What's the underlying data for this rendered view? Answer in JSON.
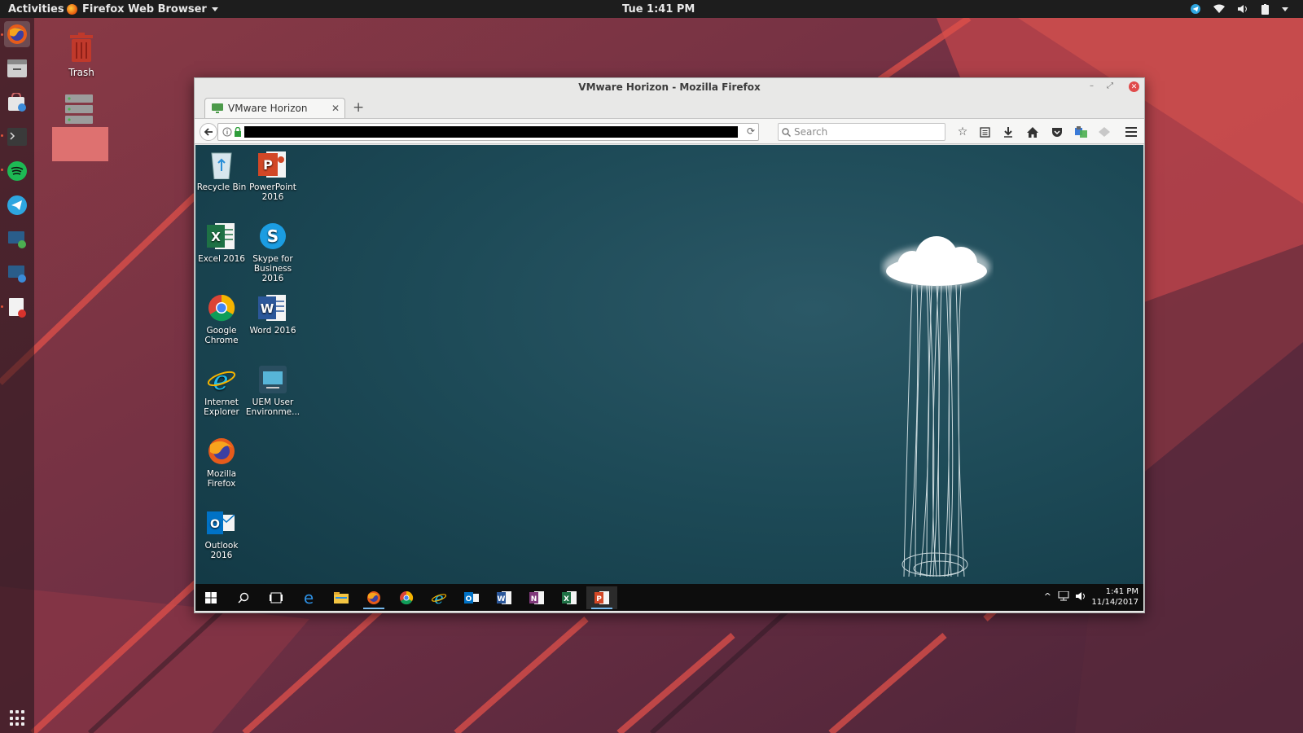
{
  "topbar": {
    "activities": "Activities",
    "app_name": "Firefox Web Browser",
    "clock": "Tue  1:41 PM"
  },
  "desktop": {
    "trash_label": "Trash"
  },
  "firefox": {
    "window_title": "VMware Horizon - Mozilla Firefox",
    "tab_title": "VMware Horizon",
    "search_placeholder": "Search"
  },
  "remote_desktop": {
    "icons": [
      {
        "label": "Recycle Bin"
      },
      {
        "label": "PowerPoint 2016"
      },
      {
        "label": "Excel 2016"
      },
      {
        "label": "Skype for Business 2016"
      },
      {
        "label": "Google Chrome"
      },
      {
        "label": "Word 2016"
      },
      {
        "label": "Internet Explorer"
      },
      {
        "label": "UEM User Environme..."
      },
      {
        "label": "Mozilla Firefox"
      },
      {
        "label": "Outlook 2016"
      }
    ],
    "clock_time": "1:41 PM",
    "clock_date": "11/14/2017"
  }
}
